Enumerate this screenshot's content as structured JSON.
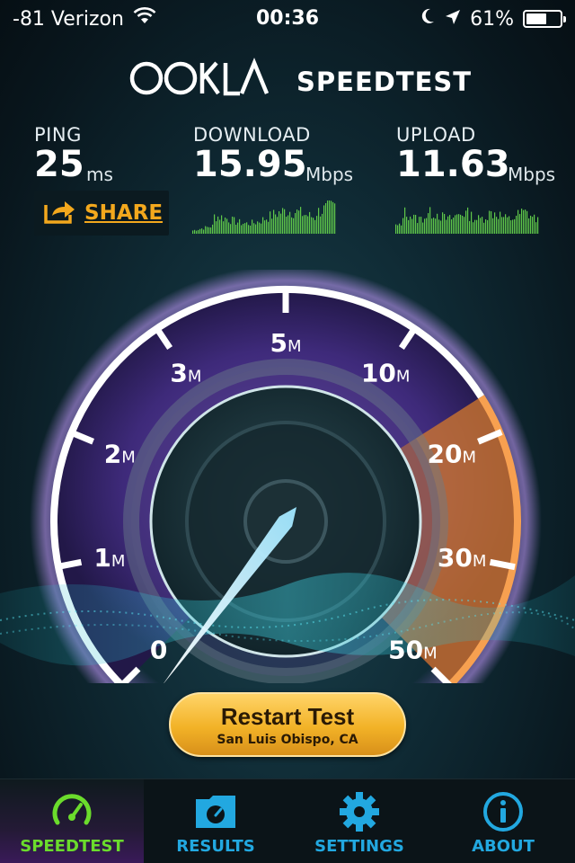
{
  "status_bar": {
    "carrier": "-81 Verizon",
    "time": "00:36",
    "battery": "61%",
    "battery_level": 0.61
  },
  "brand": {
    "logo": "OOKLA",
    "title": "SPEEDTEST"
  },
  "stats": {
    "ping": {
      "label": "PING",
      "value": "25",
      "unit": "ms"
    },
    "download": {
      "label": "DOWNLOAD",
      "value": "15.95",
      "unit": "Mbps"
    },
    "upload": {
      "label": "UPLOAD",
      "value": "11.63",
      "unit": "Mbps"
    }
  },
  "share_button": {
    "label": "SHARE"
  },
  "gauge": {
    "scale": [
      {
        "num": "0",
        "unit": ""
      },
      {
        "num": "1",
        "unit": "M"
      },
      {
        "num": "2",
        "unit": "M"
      },
      {
        "num": "3",
        "unit": "M"
      },
      {
        "num": "5",
        "unit": "M"
      },
      {
        "num": "10",
        "unit": "M"
      },
      {
        "num": "20",
        "unit": "M"
      },
      {
        "num": "30",
        "unit": "M"
      },
      {
        "num": "50",
        "unit": "M"
      }
    ],
    "needle_value": "0"
  },
  "restart_button": {
    "label": "Restart Test",
    "server": "San Luis Obispo, CA"
  },
  "tabs": [
    {
      "label": "SPEEDTEST",
      "icon": "speedometer-icon",
      "active": true
    },
    {
      "label": "RESULTS",
      "icon": "folder-gauge-icon",
      "active": false
    },
    {
      "label": "SETTINGS",
      "icon": "gear-icon",
      "active": false
    },
    {
      "label": "ABOUT",
      "icon": "info-icon",
      "active": false
    }
  ],
  "colors": {
    "accent_orange": "#f3a81d",
    "tab_blue": "#22a8e0",
    "tab_active_green": "#6bdc2c",
    "spark_green": "#5fc84a"
  }
}
